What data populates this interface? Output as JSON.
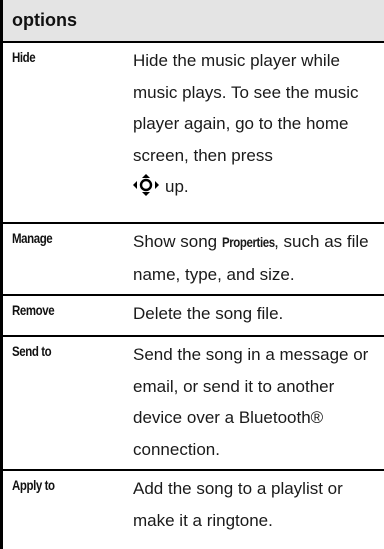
{
  "header": {
    "title": "options"
  },
  "rows": [
    {
      "term": "Hide",
      "desc_text": "Hide the music player while music plays. To see the music player again, go to the home screen, then press",
      "desc_after_icon": "up.",
      "icon": "navigation-key-icon"
    },
    {
      "term": "Manage",
      "desc_prefix": "Show song",
      "desc_bold": "Properties",
      "desc_suffix": ", such as file name, type, and size."
    },
    {
      "term": "Remove",
      "desc": "Delete the song file."
    },
    {
      "term": "Send to",
      "desc": "Send the song in a message or email, or send it to another device over a Bluetooth® connection."
    },
    {
      "term": "Apply to",
      "desc": "Add the song to a playlist or make it a ringtone."
    }
  ]
}
